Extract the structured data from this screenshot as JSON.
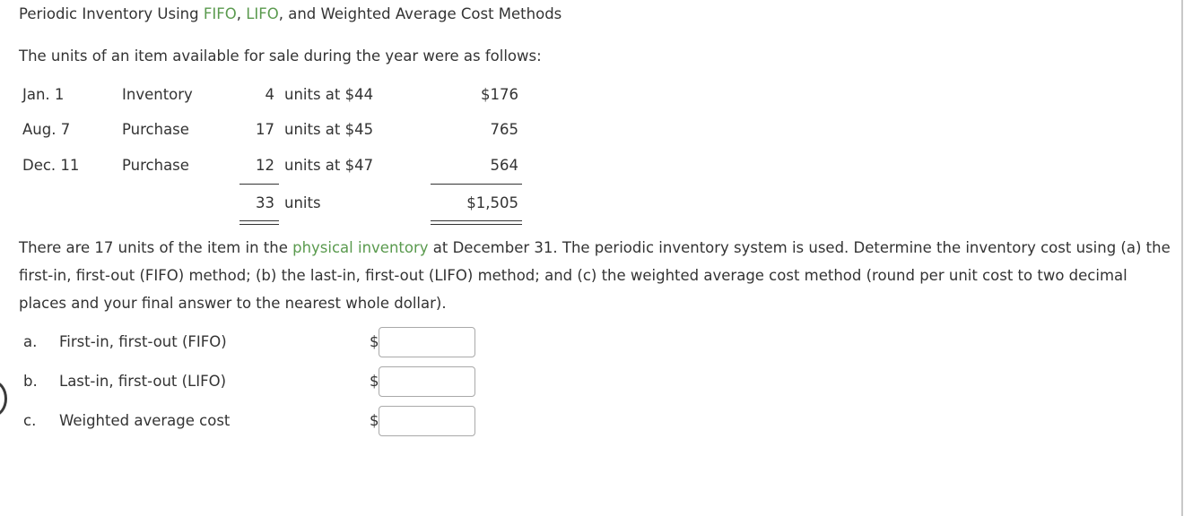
{
  "title": {
    "prefix": "Periodic Inventory Using ",
    "term1": "FIFO",
    "sep1": ", ",
    "term2": "LIFO",
    "suffix": ", and Weighted Average Cost Methods"
  },
  "intro": "The units of an item available for sale during the year were as follows:",
  "inventory_table": {
    "rows": [
      {
        "date": "Jan. 1",
        "type": "Inventory",
        "qty": "4",
        "unit_text": "units at $44",
        "amount": "$176"
      },
      {
        "date": "Aug. 7",
        "type": "Purchase",
        "qty": "17",
        "unit_text": "units at $45",
        "amount": "765"
      },
      {
        "date": "Dec. 11",
        "type": "Purchase",
        "qty": "12",
        "unit_text": "units at $47",
        "amount": "564"
      }
    ],
    "total": {
      "qty": "33",
      "unit_text": "units",
      "amount": "$1,505"
    }
  },
  "question": {
    "part1": "There are 17 units of the item in the ",
    "link": "physical inventory",
    "part2": " at December 31. The periodic inventory system is used. Determine the inventory cost using (a) the first-in, first-out (FIFO) method; (b) the last-in, first-out (LIFO) method; and (c) the weighted average cost method (round per unit cost to two decimal places and your final answer to the nearest whole dollar)."
  },
  "answers": [
    {
      "letter": "a.",
      "label": "First-in, first-out (FIFO)",
      "currency": "$",
      "value": ""
    },
    {
      "letter": "b.",
      "label": "Last-in, first-out (LIFO)",
      "currency": "$",
      "value": ""
    },
    {
      "letter": "c.",
      "label": "Weighted average cost",
      "currency": "$",
      "value": ""
    }
  ],
  "colors": {
    "link_green": "#5a9a4e",
    "text": "#333333"
  }
}
